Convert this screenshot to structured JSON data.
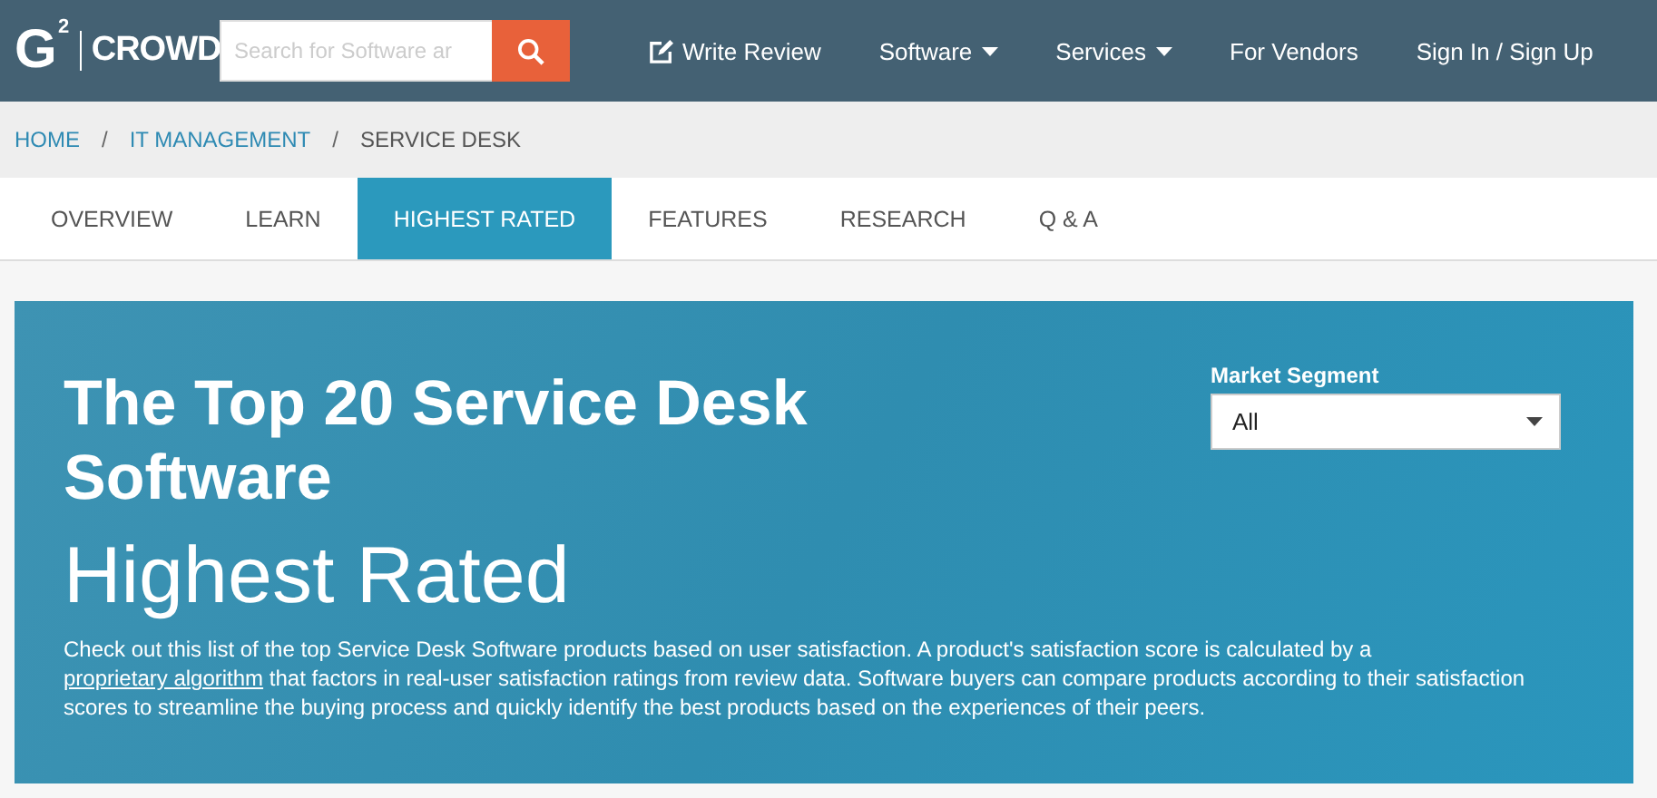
{
  "header": {
    "logo_mark": "G",
    "logo_sup": "2",
    "logo_text": "CROWD",
    "search": {
      "placeholder": "Search for Software ar"
    },
    "nav": [
      {
        "label": "Write Review",
        "kind": "icon"
      },
      {
        "label": "Software",
        "kind": "dropdown"
      },
      {
        "label": "Services",
        "kind": "dropdown"
      },
      {
        "label": "For Vendors",
        "kind": "plain"
      },
      {
        "label": "Sign In / Sign Up",
        "kind": "plain"
      }
    ]
  },
  "breadcrumbs": [
    {
      "label": "HOME",
      "kind": "link"
    },
    {
      "label": "IT MANAGEMENT",
      "kind": "link"
    },
    {
      "label": "SERVICE DESK",
      "kind": "current"
    }
  ],
  "breadcrumb_separator": "/",
  "tabs": [
    {
      "label": "OVERVIEW",
      "selected": false
    },
    {
      "label": "LEARN",
      "selected": false
    },
    {
      "label": "HIGHEST RATED",
      "selected": true
    },
    {
      "label": "FEATURES",
      "selected": false
    },
    {
      "label": "RESEARCH",
      "selected": false
    },
    {
      "label": "Q & A",
      "selected": false
    }
  ],
  "hero": {
    "title": "The Top 20 Service Desk Software",
    "subtitle": "Highest Rated",
    "description_start": "Check out this list of the top Service Desk Software products based on user satisfaction. A product's satisfaction score is calculated by a",
    "description_link": "proprietary algorithm",
    "description_end": "that factors in real-user satisfaction ratings from review data. Software buyers can compare products according to their satisfaction scores to streamline the buying process and quickly identify the best products based on the experiences of their peers.",
    "filter": {
      "label": "Market Segment",
      "value": "All"
    }
  }
}
